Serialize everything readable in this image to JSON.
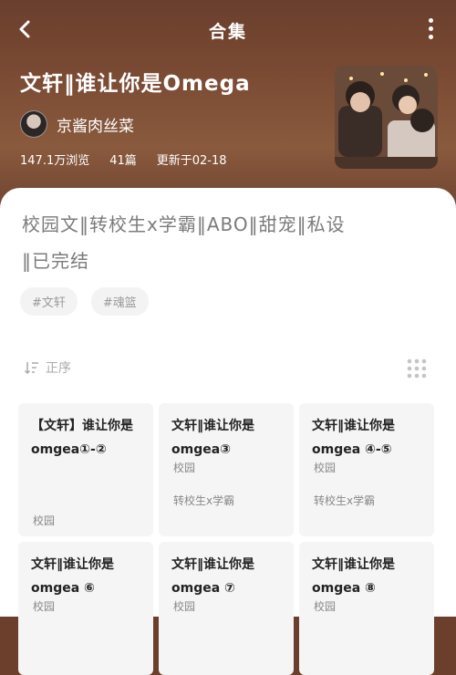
{
  "header": {
    "title": "合集"
  },
  "collection": {
    "title": "文轩‖谁让你是Omega",
    "author": "京酱肉丝菜",
    "views": "147.1万浏览",
    "count": "41篇",
    "updated": "更新于02-18",
    "description_line1": "校园文‖转校生x学霸‖ABO‖甜宠‖私设",
    "description_line2": "‖已完结",
    "tags": [
      "#文轩",
      "#魂篮"
    ]
  },
  "toolbar": {
    "sort_label": "正序"
  },
  "chapters": [
    {
      "title": "【文轩】谁让你是omgea①-②",
      "tags": [],
      "bottom_tag": "校园"
    },
    {
      "title": "文轩‖谁让你是omgea③",
      "tags": [
        "校园",
        "转校生x学霸"
      ],
      "bottom_tag": ""
    },
    {
      "title": "文轩‖谁让你是omgea ④-⑤",
      "tags": [
        "校园",
        "转校生x学霸"
      ],
      "bottom_tag": ""
    },
    {
      "title": "文轩‖谁让你是omgea ⑥",
      "tags": [
        "校园"
      ],
      "bottom_tag": ""
    },
    {
      "title": "文轩‖谁让你是omgea ⑦",
      "tags": [
        "校园"
      ],
      "bottom_tag": ""
    },
    {
      "title": "文轩‖谁让你是omgea ⑧",
      "tags": [
        "校园"
      ],
      "bottom_tag": ""
    }
  ],
  "icons": {
    "back": "back-arrow-icon",
    "more": "more-vertical-icon",
    "sort": "sort-icon",
    "grid": "grid-view-icon"
  },
  "colors": {
    "hero_background": "#7a4a33",
    "text_primary": "#ffffff",
    "sheet_background": "#ffffff",
    "card_background": "#f5f5f5"
  }
}
